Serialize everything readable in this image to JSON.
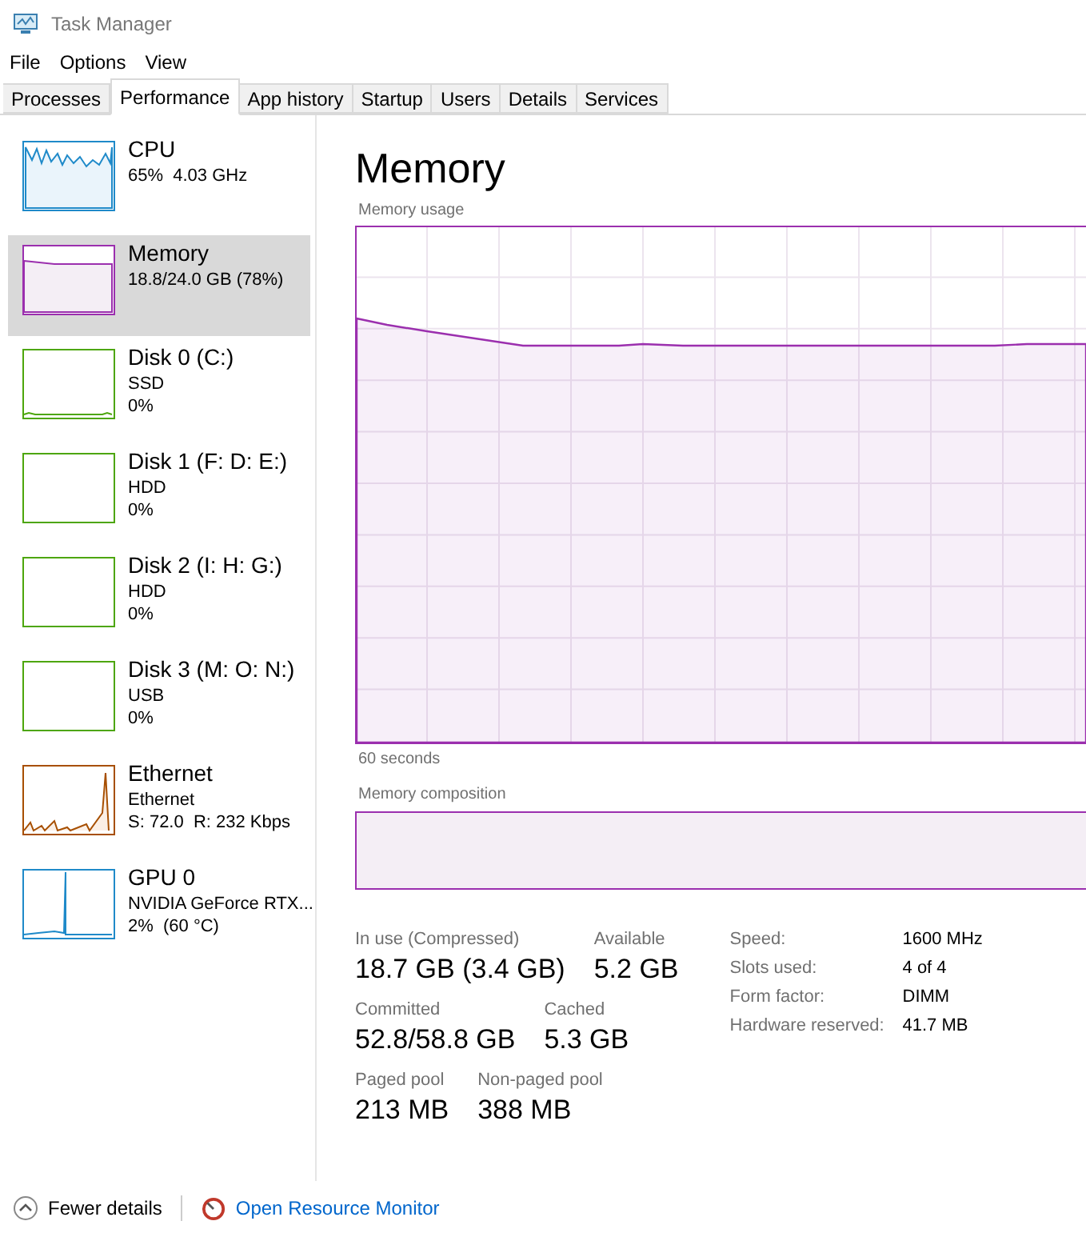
{
  "window": {
    "title": "Task Manager"
  },
  "menu": [
    "File",
    "Options",
    "View"
  ],
  "tabs": [
    {
      "label": "Processes",
      "selected": false
    },
    {
      "label": "Performance",
      "selected": true
    },
    {
      "label": "App history",
      "selected": false
    },
    {
      "label": "Startup",
      "selected": false
    },
    {
      "label": "Users",
      "selected": false
    },
    {
      "label": "Details",
      "selected": false
    },
    {
      "label": "Services",
      "selected": false
    }
  ],
  "sidebar": {
    "items": [
      {
        "kind": "cpu",
        "name": "CPU",
        "lines": [
          "65%  4.03 GHz"
        ],
        "selected": false,
        "color": "#1f8ac9"
      },
      {
        "kind": "memory",
        "name": "Memory",
        "lines": [
          "18.8/24.0 GB (78%)"
        ],
        "selected": true,
        "color": "#9b2fae"
      },
      {
        "kind": "disk",
        "name": "Disk 0 (C:)",
        "lines": [
          "SSD",
          "0%"
        ],
        "selected": false,
        "color": "#4da60c"
      },
      {
        "kind": "disk",
        "name": "Disk 1 (F: D: E:)",
        "lines": [
          "HDD",
          "0%"
        ],
        "selected": false,
        "color": "#4da60c"
      },
      {
        "kind": "disk",
        "name": "Disk 2 (I: H: G:)",
        "lines": [
          "HDD",
          "0%"
        ],
        "selected": false,
        "color": "#4da60c"
      },
      {
        "kind": "disk",
        "name": "Disk 3 (M: O: N:)",
        "lines": [
          "USB",
          "0%"
        ],
        "selected": false,
        "color": "#4da60c"
      },
      {
        "kind": "ethernet",
        "name": "Ethernet",
        "lines": [
          "Ethernet",
          "S: 72.0  R: 232 Kbps"
        ],
        "selected": false,
        "color": "#a74f01"
      },
      {
        "kind": "gpu",
        "name": "GPU 0",
        "lines": [
          "NVIDIA GeForce RTX...",
          "2%  (60 °C)"
        ],
        "selected": false,
        "color": "#1f8ac9"
      }
    ]
  },
  "main": {
    "title": "Memory",
    "usage_label": "Memory usage",
    "time_label": "60 seconds",
    "composition_label": "Memory composition",
    "stats": [
      [
        {
          "label": "In use (Compressed)",
          "value": "18.7 GB (3.4 GB)"
        },
        {
          "label": "Available",
          "value": "5.2 GB"
        }
      ],
      [
        {
          "label": "Committed",
          "value": "52.8/58.8 GB"
        },
        {
          "label": "Cached",
          "value": "5.3 GB"
        }
      ],
      [
        {
          "label": "Paged pool",
          "value": "213 MB"
        },
        {
          "label": "Non-paged pool",
          "value": "388 MB"
        }
      ]
    ],
    "details": [
      {
        "key": "Speed:",
        "value": "1600 MHz"
      },
      {
        "key": "Slots used:",
        "value": "4 of 4"
      },
      {
        "key": "Form factor:",
        "value": "DIMM"
      },
      {
        "key": "Hardware reserved:",
        "value": "41.7 MB"
      }
    ]
  },
  "footer": {
    "fewer_details": "Fewer details",
    "resource_monitor": "Open Resource Monitor"
  }
}
